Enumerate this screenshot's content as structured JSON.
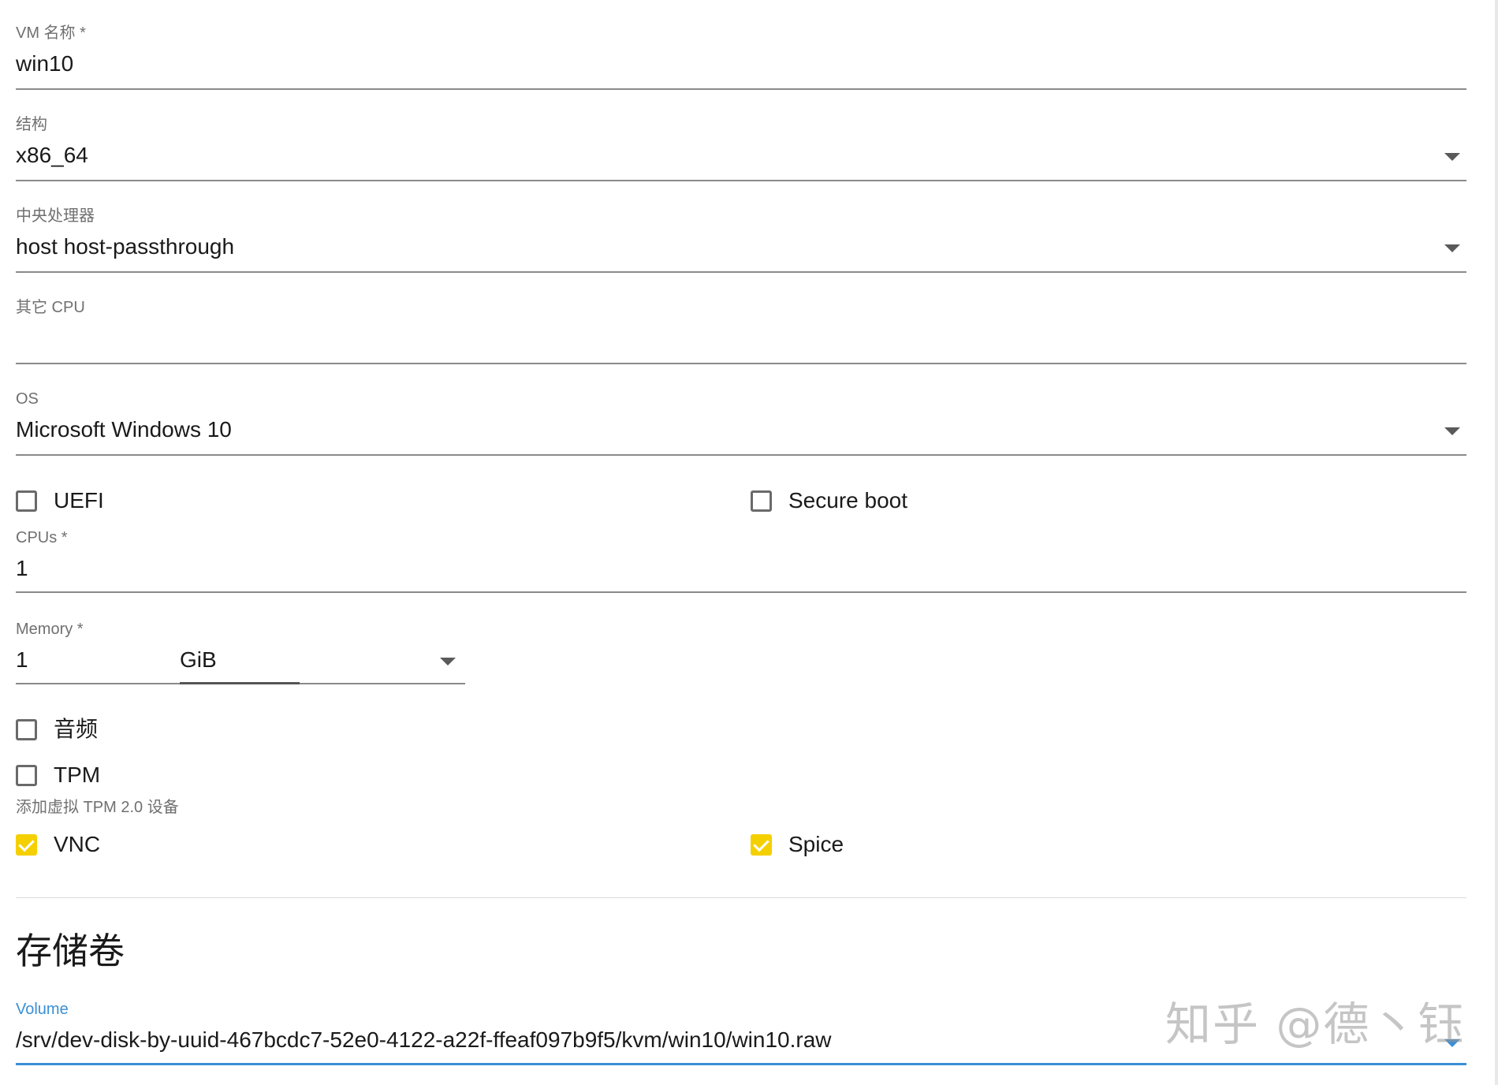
{
  "form": {
    "vm_name": {
      "label": "VM 名称 *",
      "value": "win10"
    },
    "architecture": {
      "label": "结构",
      "value": "x86_64"
    },
    "cpu_model": {
      "label": "中央处理器",
      "value": "host host-passthrough"
    },
    "other_cpu": {
      "label": "其它 CPU",
      "value": ""
    },
    "os": {
      "label": "OS",
      "value": "Microsoft Windows 10"
    },
    "uefi": {
      "label": "UEFI",
      "checked": false
    },
    "secure_boot": {
      "label": "Secure boot",
      "checked": false
    },
    "cpus": {
      "label": "CPUs *",
      "value": "1"
    },
    "memory": {
      "label": "Memory *",
      "value": "1",
      "unit": "GiB"
    },
    "audio": {
      "label": "音频",
      "checked": false
    },
    "tpm": {
      "label": "TPM",
      "checked": false,
      "helper": "添加虚拟 TPM 2.0 设备"
    },
    "vnc": {
      "label": "VNC",
      "checked": true
    },
    "spice": {
      "label": "Spice",
      "checked": true
    }
  },
  "storage": {
    "title": "存储卷",
    "volume": {
      "label": "Volume",
      "value": "/srv/dev-disk-by-uuid-467bcdc7-52e0-4122-a22f-ffeaf097b9f5/kvm/win10/win10.raw"
    }
  },
  "watermark": "知乎 @德丶钰",
  "colors": {
    "checked_box": "#f5d000",
    "focus_accent": "#3a8fd6",
    "label_gray": "#707070"
  }
}
